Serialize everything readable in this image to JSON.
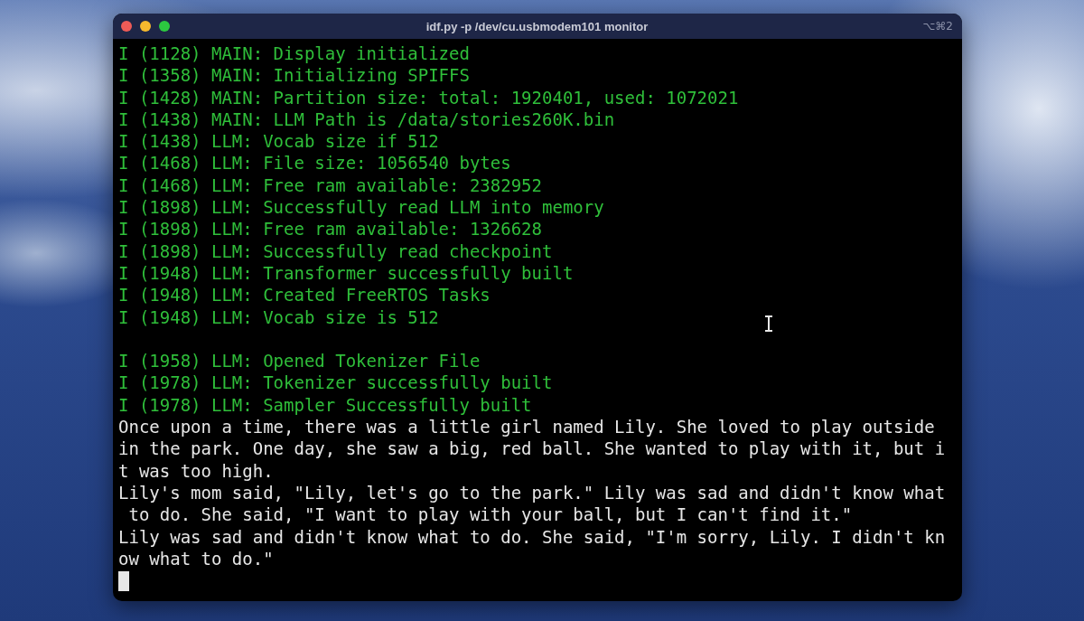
{
  "window": {
    "title": "idf.py -p /dev/cu.usbmodem101 monitor",
    "shortcut": "⌥⌘2"
  },
  "terminal": {
    "cursor": true,
    "lines": [
      {
        "kind": "log",
        "text": "I (1128) MAIN: Display initialized"
      },
      {
        "kind": "log",
        "text": "I (1358) MAIN: Initializing SPIFFS"
      },
      {
        "kind": "log",
        "text": "I (1428) MAIN: Partition size: total: 1920401, used: 1072021"
      },
      {
        "kind": "log",
        "text": "I (1438) MAIN: LLM Path is /data/stories260K.bin"
      },
      {
        "kind": "log",
        "text": "I (1438) LLM: Vocab size if 512"
      },
      {
        "kind": "log",
        "text": "I (1468) LLM: File size: 1056540 bytes"
      },
      {
        "kind": "log",
        "text": "I (1468) LLM: Free ram available: 2382952"
      },
      {
        "kind": "log",
        "text": "I (1898) LLM: Successfully read LLM into memory"
      },
      {
        "kind": "log",
        "text": "I (1898) LLM: Free ram available: 1326628"
      },
      {
        "kind": "log",
        "text": "I (1898) LLM: Successfully read checkpoint"
      },
      {
        "kind": "log",
        "text": "I (1948) LLM: Transformer successfully built"
      },
      {
        "kind": "log",
        "text": "I (1948) LLM: Created FreeRTOS Tasks"
      },
      {
        "kind": "log",
        "text": "I (1948) LLM: Vocab size is 512"
      },
      {
        "kind": "blank"
      },
      {
        "kind": "log",
        "text": "I (1958) LLM: Opened Tokenizer File"
      },
      {
        "kind": "log",
        "text": "I (1978) LLM: Tokenizer successfully built"
      },
      {
        "kind": "log",
        "text": "I (1978) LLM: Sampler Successfully built"
      },
      {
        "kind": "output",
        "text": "Once upon a time, there was a little girl named Lily. She loved to play outside"
      },
      {
        "kind": "output",
        "text": "in the park. One day, she saw a big, red ball. She wanted to play with it, but i"
      },
      {
        "kind": "output",
        "text": "t was too high."
      },
      {
        "kind": "output",
        "text": "Lily's mom said, \"Lily, let's go to the park.\" Lily was sad and didn't know what"
      },
      {
        "kind": "output",
        "text": " to do. She said, \"I want to play with your ball, but I can't find it.\""
      },
      {
        "kind": "output",
        "text": "Lily was sad and didn't know what to do. She said, \"I'm sorry, Lily. I didn't kn"
      },
      {
        "kind": "output",
        "text": "ow what to do.\""
      }
    ]
  }
}
